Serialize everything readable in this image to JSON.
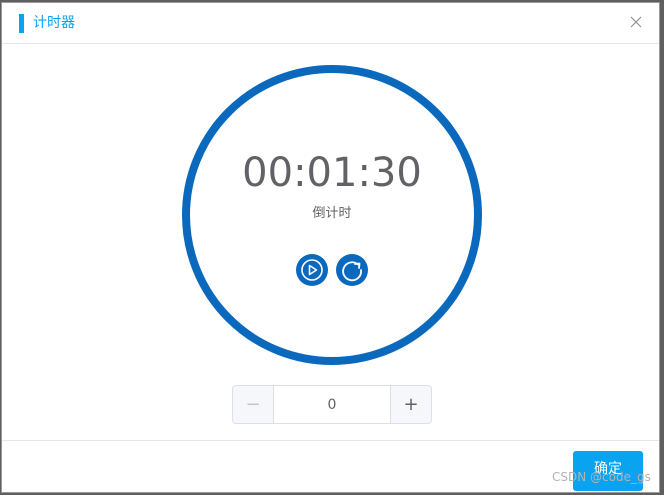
{
  "dialog": {
    "title": "计时器",
    "accent_color": "#0aa3f0",
    "close_icon": "close-icon"
  },
  "timer": {
    "time": "00:01:30",
    "mode": "倒计时",
    "ring_color": "#0b69bd",
    "controls": [
      {
        "name": "play",
        "icon": "play-icon"
      },
      {
        "name": "reset",
        "icon": "refresh-icon"
      }
    ]
  },
  "stepper": {
    "value": "0",
    "minus_label": "−",
    "plus_label": "+"
  },
  "footer": {
    "confirm_label": "确定"
  },
  "watermark": "CSDN @code_gs"
}
